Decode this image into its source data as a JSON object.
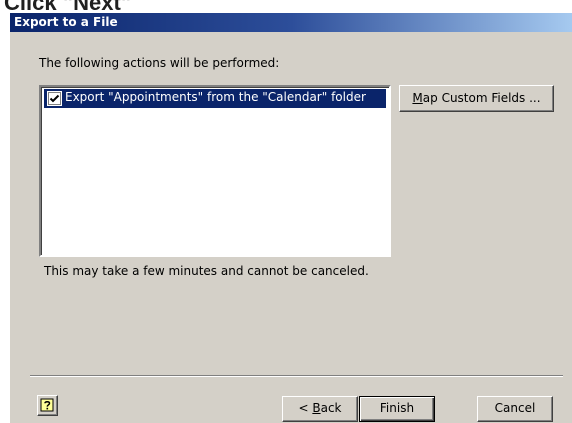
{
  "page": {
    "header_fragment": "Click \"Next\""
  },
  "dialog": {
    "title": "Export to a File",
    "intro_label": "The following actions will be performed:",
    "actions": [
      {
        "label": "Export \"Appointments\" from the \"Calendar\" folder",
        "checked": true
      }
    ],
    "map_fields_button": {
      "accel": "M",
      "rest": "ap Custom Fields ..."
    },
    "note": "This may take a few minutes and cannot be canceled.",
    "buttons": {
      "help_icon": "help-question-icon",
      "back_prefix": "< ",
      "back_accel": "B",
      "back_rest": "ack",
      "finish": "Finish",
      "cancel": "Cancel"
    },
    "colors": {
      "face": "#d4d0c8",
      "title_start": "#0a246a",
      "title_end": "#a6caf0",
      "selection": "#0a246a"
    }
  }
}
